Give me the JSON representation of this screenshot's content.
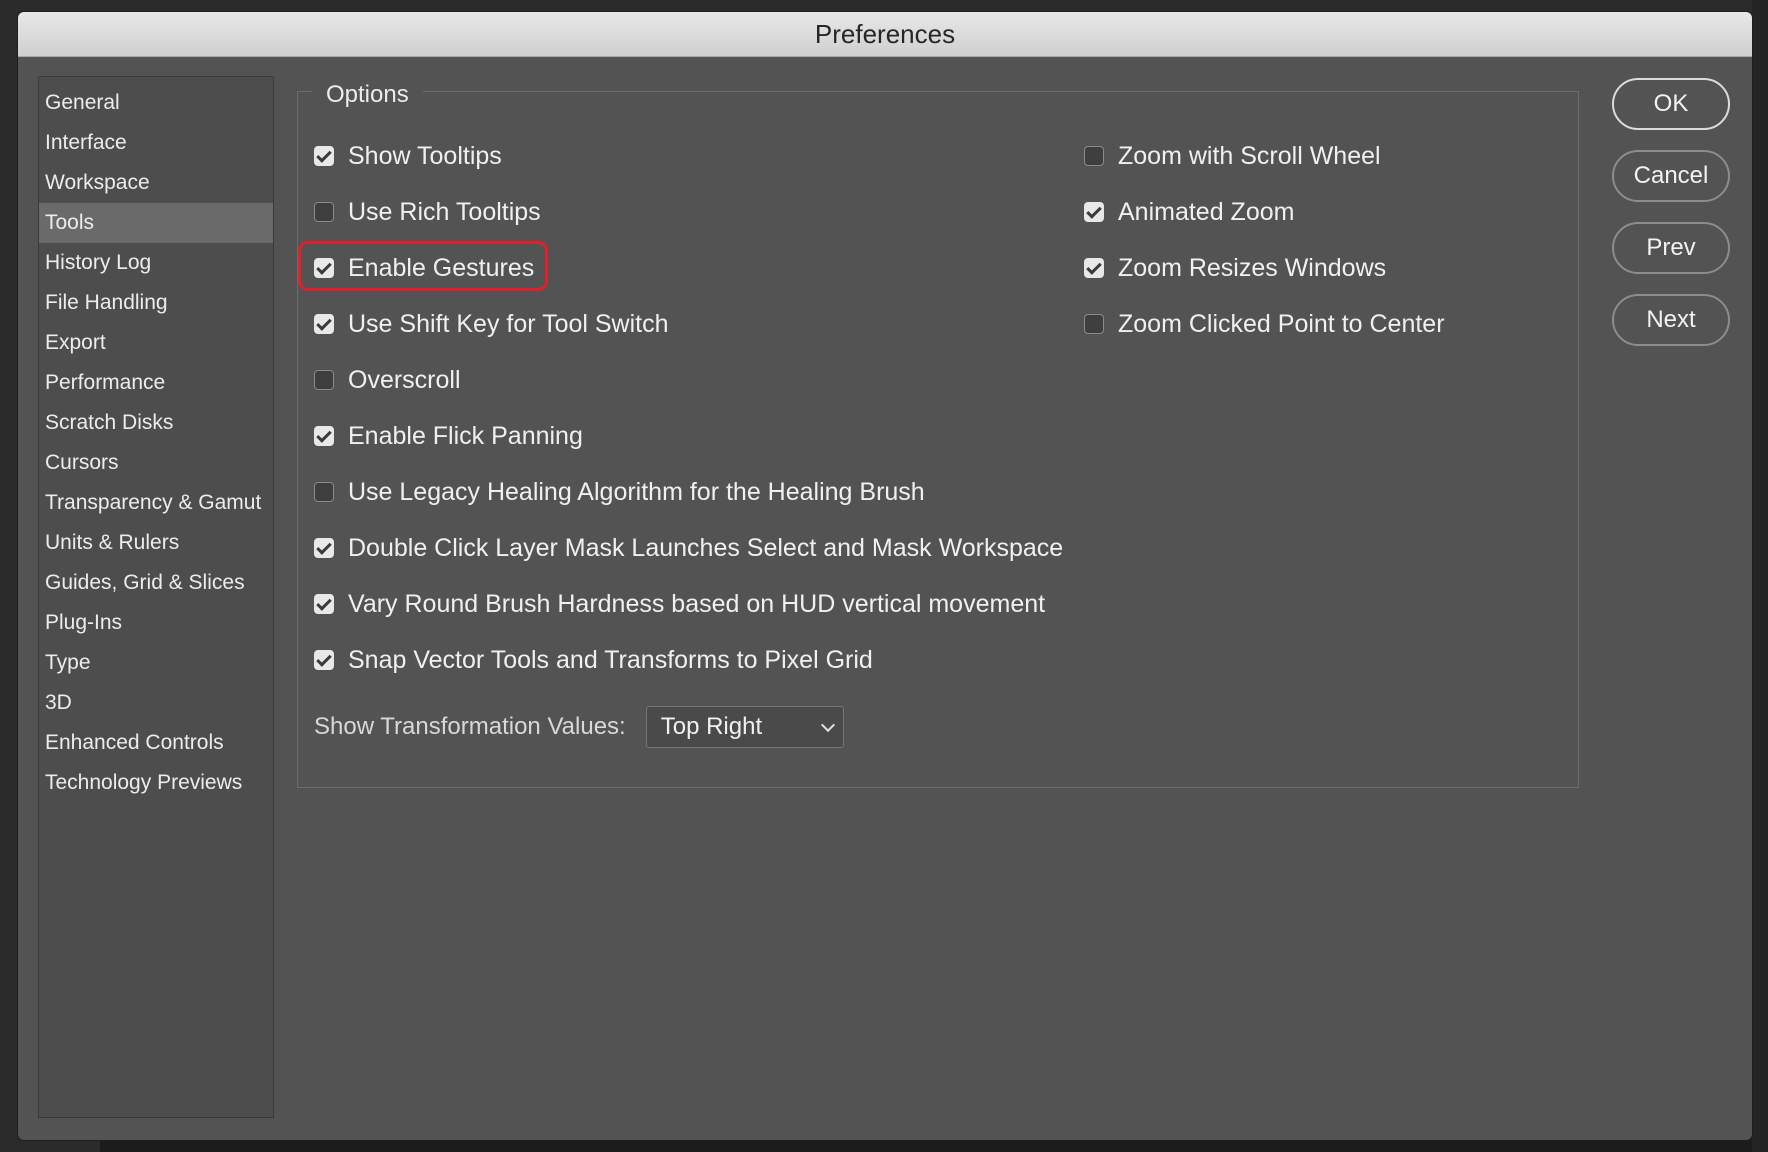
{
  "window": {
    "title": "Preferences"
  },
  "sidebar": {
    "items": [
      {
        "label": "General",
        "selected": false
      },
      {
        "label": "Interface",
        "selected": false
      },
      {
        "label": "Workspace",
        "selected": false
      },
      {
        "label": "Tools",
        "selected": true
      },
      {
        "label": "History Log",
        "selected": false
      },
      {
        "label": "File Handling",
        "selected": false
      },
      {
        "label": "Export",
        "selected": false
      },
      {
        "label": "Performance",
        "selected": false
      },
      {
        "label": "Scratch Disks",
        "selected": false
      },
      {
        "label": "Cursors",
        "selected": false
      },
      {
        "label": "Transparency & Gamut",
        "selected": false
      },
      {
        "label": "Units & Rulers",
        "selected": false
      },
      {
        "label": "Guides, Grid & Slices",
        "selected": false
      },
      {
        "label": "Plug-Ins",
        "selected": false
      },
      {
        "label": "Type",
        "selected": false
      },
      {
        "label": "3D",
        "selected": false
      },
      {
        "label": "Enhanced Controls",
        "selected": false
      },
      {
        "label": "Technology Previews",
        "selected": false
      }
    ]
  },
  "options": {
    "legend": "Options",
    "left": [
      {
        "label": "Show Tooltips",
        "checked": true
      },
      {
        "label": "Use Rich Tooltips",
        "checked": false
      },
      {
        "label": "Enable Gestures",
        "checked": true,
        "highlighted": true
      },
      {
        "label": "Use Shift Key for Tool Switch",
        "checked": true
      },
      {
        "label": "Overscroll",
        "checked": false
      },
      {
        "label": "Enable Flick Panning",
        "checked": true
      },
      {
        "label": "Use Legacy Healing Algorithm for the Healing Brush",
        "checked": false
      },
      {
        "label": "Double Click Layer Mask Launches Select and Mask Workspace",
        "checked": true
      },
      {
        "label": "Vary Round Brush Hardness based on HUD vertical movement",
        "checked": true
      },
      {
        "label": "Snap Vector Tools and Transforms to Pixel Grid",
        "checked": true
      }
    ],
    "right": [
      {
        "label": "Zoom with Scroll Wheel",
        "checked": false
      },
      {
        "label": "Animated Zoom",
        "checked": true
      },
      {
        "label": "Zoom Resizes Windows",
        "checked": true
      },
      {
        "label": "Zoom Clicked Point to Center",
        "checked": false
      }
    ],
    "transform": {
      "label": "Show Transformation Values:",
      "value": "Top Right"
    }
  },
  "buttons": {
    "ok": "OK",
    "cancel": "Cancel",
    "prev": "Prev",
    "next": "Next"
  },
  "colors": {
    "highlight": "#e0202b",
    "panel": "#535353",
    "selected_item": "#6a6a6a"
  }
}
